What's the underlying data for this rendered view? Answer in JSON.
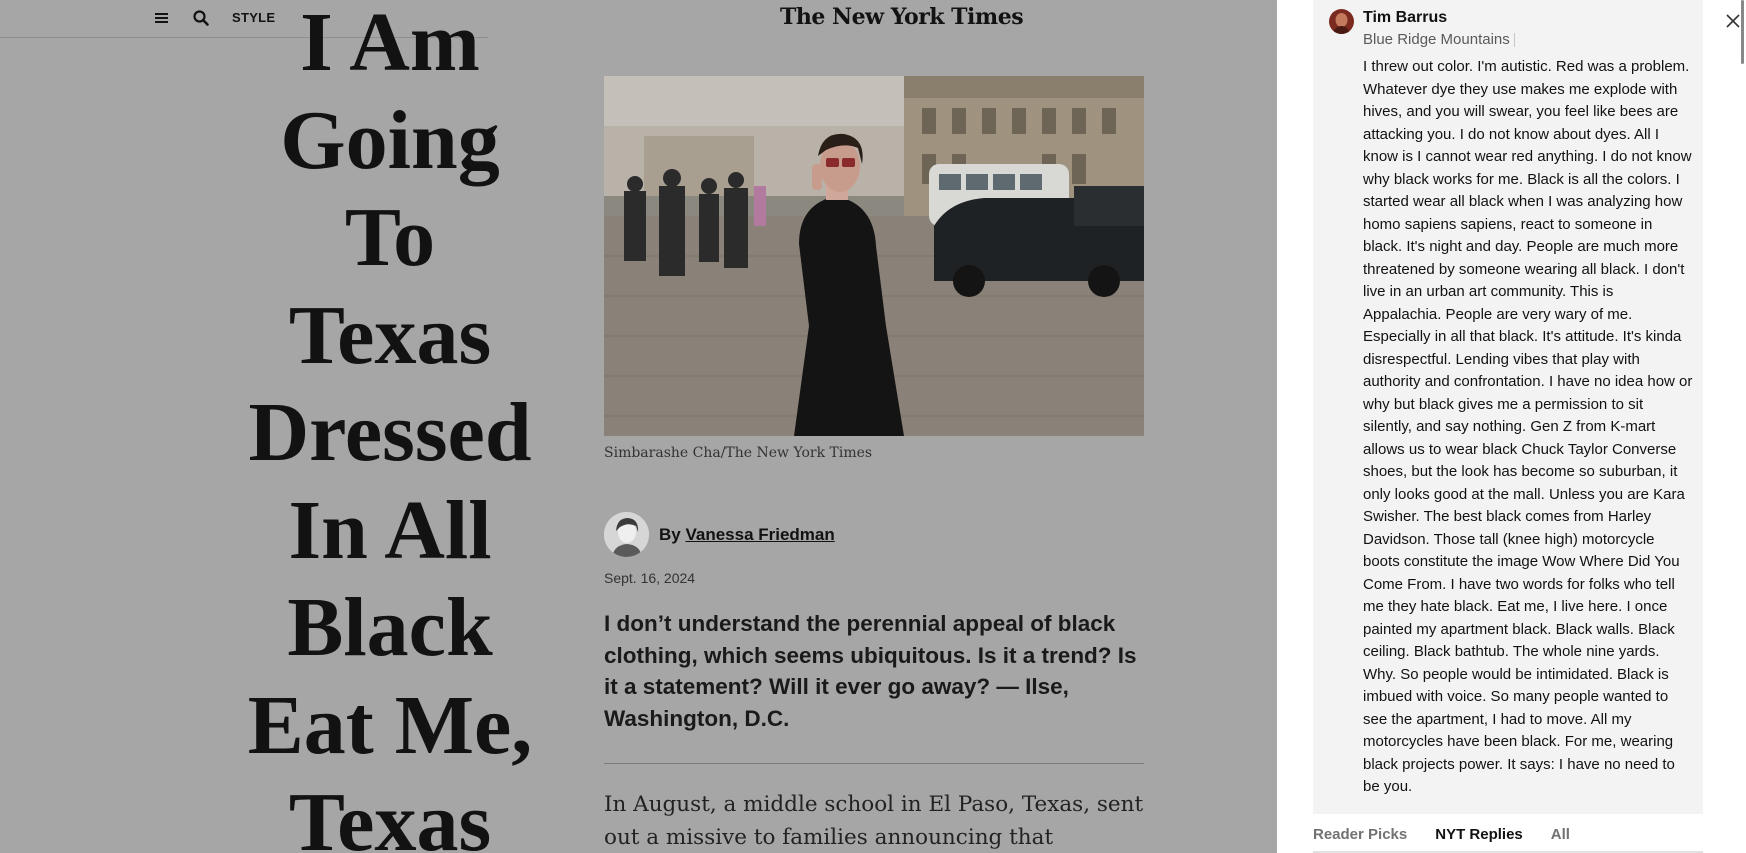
{
  "header": {
    "section_label": "STYLE",
    "masthead": "The New York Times",
    "icons": [
      "hamburger-menu-icon",
      "search-icon"
    ]
  },
  "article": {
    "headline_lines": [
      "I Am",
      "Going",
      "To",
      "Texas",
      "Dressed",
      "In All",
      "Black",
      "Eat Me,",
      "Texas"
    ],
    "photo_credit": "Simbarashe Cha/The New York Times",
    "byline_prefix": "By",
    "author": "Vanessa Friedman",
    "date": "Sept. 16, 2024",
    "question": "I don’t understand the perennial appeal of black clothing, which seems ubiquitous. Is it a trend? Is it a statement? Will it ever go away? — Ilse, Washington, D.C.",
    "body_start": "In August, a middle school in El Paso, Texas, sent out a missive to families announcing that students were"
  },
  "comments": {
    "commenter_name": "Tim Barrus",
    "commenter_location": "Blue Ridge Mountains",
    "comment_body": "I threw out color. I'm autistic. Red was a problem. Whatever dye they use makes me explode with hives, and you will swear, you feel like bees are attacking you. I do not know about dyes. All I know is I cannot wear red anything. I do not know why black works for me. Black is all the colors. I started wear all black when I was analyzing how homo sapiens sapiens, react to someone in black. It's night and day. People are much more threatened by someone wearing all black. I don't live in an urban art community. This is Appalachia. People are very wary of me. Especially in all that black. It's attitude. It's kinda disrespectful. Lending vibes that play with authority and confrontation. I have no idea how or why but black gives me a permission to sit silently, and say nothing. Gen Z from K-mart allows us to wear black Chuck Taylor Converse shoes, but the look has become so suburban, it only looks good at the mall. Unless you are Kara Swisher. The best black comes from Harley Davidson. Those tall (knee high) motorcycle boots constitute the image Wow Where Did You Come From. I have two words for folks who tell me they hate black. Eat me, I live here. I once painted my apartment black. Black walls. Black ceiling. Black bathtub. The whole nine yards. Why. So people would be intimidated. Black is imbued with voice. So many people wanted to see the apartment, I had to move. All my motorcycles have been black. For me, wearing black projects power. It says: I have no need to be you.",
    "tabs": [
      {
        "label": "Reader Picks",
        "active": false
      },
      {
        "label": "NYT Replies",
        "active": true
      },
      {
        "label": "All",
        "active": false
      }
    ]
  },
  "colors": {
    "dim_overlay": "#a6a6a6",
    "panel_bg": "#ffffff",
    "comment_card_bg": "#f3f3f3",
    "text_primary": "#121212"
  }
}
